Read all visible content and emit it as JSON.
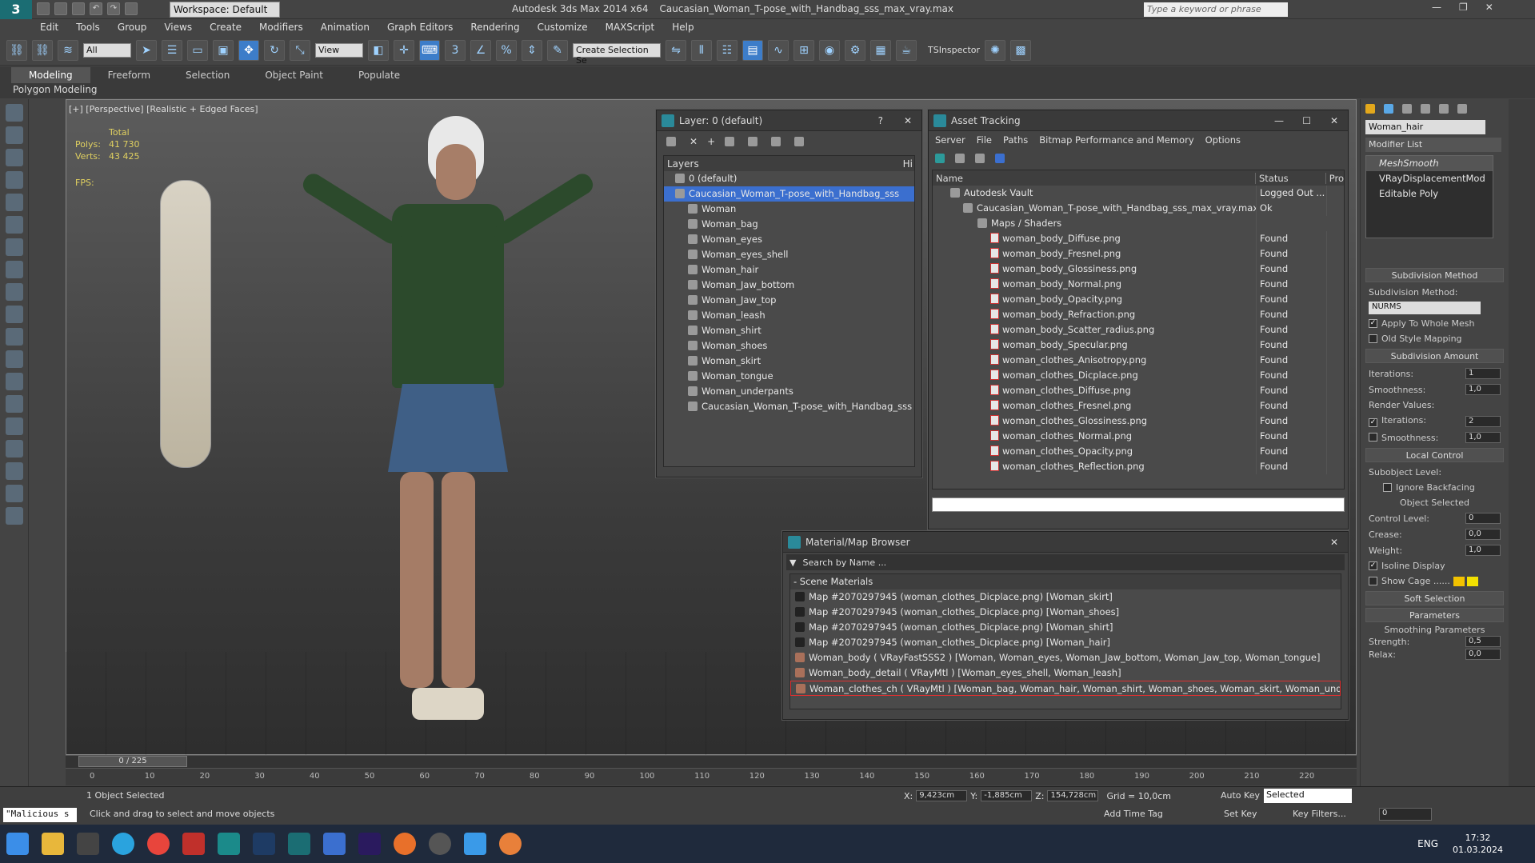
{
  "app": {
    "title": "Autodesk 3ds Max  2014 x64",
    "file": "Caucasian_Woman_T-pose_with_Handbag_sss_max_vray.max",
    "workspace": "Workspace: Default",
    "search_placeholder": "Type a keyword or phrase"
  },
  "menu": [
    "Edit",
    "Tools",
    "Group",
    "Views",
    "Create",
    "Modifiers",
    "Animation",
    "Graph Editors",
    "Rendering",
    "Customize",
    "MAXScript",
    "Help"
  ],
  "toolbar": {
    "filter": "All",
    "view": "View",
    "selection_set": "Create Selection Se",
    "tsinspector": "TSInspector"
  },
  "ribbon": {
    "tabs": [
      "Modeling",
      "Freeform",
      "Selection",
      "Object Paint",
      "Populate"
    ],
    "sub": "Polygon Modeling"
  },
  "viewport": {
    "label": "[+] [Perspective] [Realistic + Edged Faces]",
    "total": "Total",
    "polys_label": "Polys:",
    "polys": "41 730",
    "verts_label": "Verts:",
    "verts": "43 425",
    "fps": "FPS:"
  },
  "layer_window": {
    "title": "Layer: 0 (default)",
    "col_layers": "Layers",
    "col_h": "Hi",
    "rows": [
      "0 (default)",
      "Caucasian_Woman_T-pose_with_Handbag_sss",
      "Woman",
      "Woman_bag",
      "Woman_eyes",
      "Woman_eyes_shell",
      "Woman_hair",
      "Woman_Jaw_bottom",
      "Woman_Jaw_top",
      "Woman_leash",
      "Woman_shirt",
      "Woman_shoes",
      "Woman_skirt",
      "Woman_tongue",
      "Woman_underpants",
      "Caucasian_Woman_T-pose_with_Handbag_sss"
    ]
  },
  "asset_window": {
    "title": "Asset Tracking",
    "menu": [
      "Server",
      "File",
      "Paths",
      "Bitmap Performance and Memory",
      "Options"
    ],
    "col_name": "Name",
    "col_status": "Status",
    "col_pro": "Pro",
    "rows": [
      {
        "name": "Autodesk Vault",
        "status": "Logged Out ..."
      },
      {
        "name": "Caucasian_Woman_T-pose_with_Handbag_sss_max_vray.max",
        "status": "Ok"
      },
      {
        "name": "Maps / Shaders",
        "status": ""
      },
      {
        "name": "woman_body_Diffuse.png",
        "status": "Found"
      },
      {
        "name": "woman_body_Fresnel.png",
        "status": "Found"
      },
      {
        "name": "woman_body_Glossiness.png",
        "status": "Found"
      },
      {
        "name": "woman_body_Normal.png",
        "status": "Found"
      },
      {
        "name": "woman_body_Opacity.png",
        "status": "Found"
      },
      {
        "name": "woman_body_Refraction.png",
        "status": "Found"
      },
      {
        "name": "woman_body_Scatter_radius.png",
        "status": "Found"
      },
      {
        "name": "woman_body_Specular.png",
        "status": "Found"
      },
      {
        "name": "woman_clothes_Anisotropy.png",
        "status": "Found"
      },
      {
        "name": "woman_clothes_Dicplace.png",
        "status": "Found"
      },
      {
        "name": "woman_clothes_Diffuse.png",
        "status": "Found"
      },
      {
        "name": "woman_clothes_Fresnel.png",
        "status": "Found"
      },
      {
        "name": "woman_clothes_Glossiness.png",
        "status": "Found"
      },
      {
        "name": "woman_clothes_Normal.png",
        "status": "Found"
      },
      {
        "name": "woman_clothes_Opacity.png",
        "status": "Found"
      },
      {
        "name": "woman_clothes_Reflection.png",
        "status": "Found"
      }
    ]
  },
  "material_browser": {
    "title": "Material/Map Browser",
    "search": "Search by Name ...",
    "section": "- Scene Materials",
    "rows": [
      "Map #2070297945 (woman_clothes_Dicplace.png) [Woman_skirt]",
      "Map #2070297945 (woman_clothes_Dicplace.png) [Woman_shoes]",
      "Map #2070297945 (woman_clothes_Dicplace.png) [Woman_shirt]",
      "Map #2070297945 (woman_clothes_Dicplace.png) [Woman_hair]",
      "Woman_body  ( VRayFastSSS2 ) [Woman, Woman_eyes, Woman_Jaw_bottom, Woman_Jaw_top, Woman_tongue]",
      "Woman_body_detail  ( VRayMtl ) [Woman_eyes_shell, Woman_leash]",
      "Woman_clothes_ch  ( VRayMtl ) [Woman_bag, Woman_hair, Woman_shirt, Woman_shoes, Woman_skirt, Woman_underpants]"
    ]
  },
  "command_panel": {
    "object_name": "Woman_hair",
    "modifier_list": "Modifier List",
    "stack": [
      "MeshSmooth",
      "VRayDisplacementMod",
      "Editable Poly"
    ],
    "subdiv_method_header": "Subdivision Method",
    "subdiv_method_label": "Subdivision Method:",
    "subdiv_method": "NURMS",
    "apply_whole": "Apply To Whole Mesh",
    "old_style": "Old Style Mapping",
    "subdiv_amount_header": "Subdivision Amount",
    "iterations_label": "Iterations:",
    "iterations": "1",
    "smoothness_label": "Smoothness:",
    "smoothness": "1,0",
    "render_values": "Render Values:",
    "r_iterations": "2",
    "r_smoothness": "1,0",
    "local_control_header": "Local Control",
    "subobject_level": "Subobject Level:",
    "ignore_backfacing": "Ignore Backfacing",
    "object_selected": "Object Selected",
    "control_level_label": "Control Level:",
    "control_level": "0",
    "crease_label": "Crease:",
    "crease": "0,0",
    "weight_label": "Weight:",
    "weight": "1,0",
    "isoline": "Isoline Display",
    "show_cage": "Show Cage ......",
    "soft_selection": "Soft Selection",
    "parameters": "Parameters",
    "smoothing_params": "Smoothing Parameters",
    "strength_label": "Strength:",
    "strength": "0,5",
    "relax_label": "Relax:",
    "relax": "0,0"
  },
  "timeline": {
    "frame": "0 / 225",
    "ticks": [
      "0",
      "10",
      "20",
      "30",
      "40",
      "50",
      "60",
      "70",
      "80",
      "90",
      "100",
      "110",
      "120",
      "130",
      "140",
      "150",
      "160",
      "170",
      "180",
      "190",
      "200",
      "210",
      "220"
    ]
  },
  "status": {
    "maxscript": "\"Malicious s",
    "selected": "1 Object Selected",
    "prompt": "Click and drag to select and move objects",
    "x": "9,423cm",
    "y": "-1,885cm",
    "z": "154,728cm",
    "grid": "Grid = 10,0cm",
    "add_time_tag": "Add Time Tag",
    "auto_key": "Auto Key",
    "selected_dd": "Selected",
    "set_key": "Set Key",
    "key_filters": "Key Filters...",
    "frame": "0"
  },
  "taskbar": {
    "lang": "ENG",
    "time": "17:32",
    "date": "01.03.2024"
  },
  "colors": {
    "accent": "#3b6fcf",
    "taskbar": "#1f2a3c",
    "stats": "#e0d060"
  }
}
